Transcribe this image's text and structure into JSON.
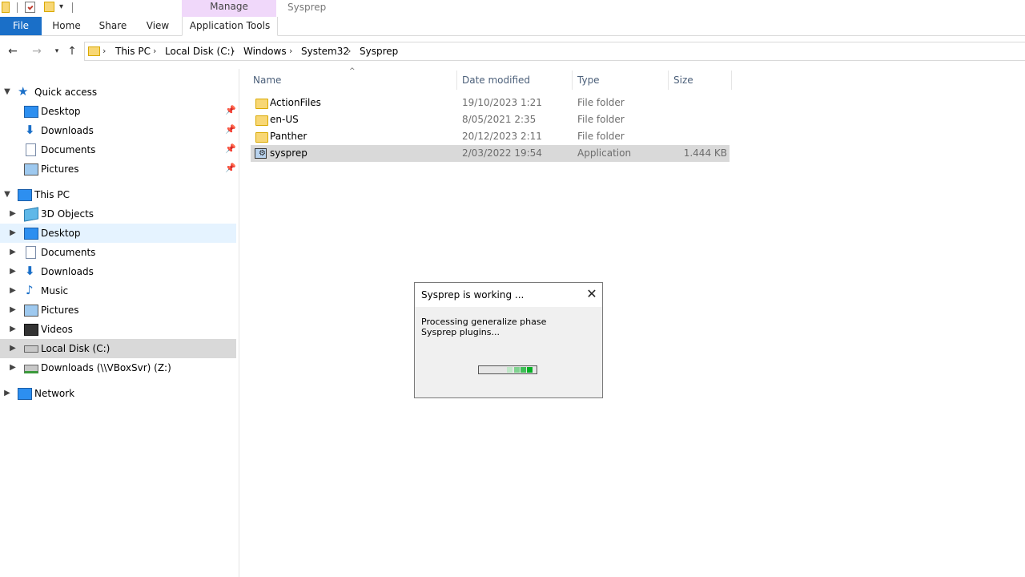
{
  "titlebar": {
    "manage_tab": "Manage",
    "window_title": "Sysprep"
  },
  "ribbon": {
    "tabs": [
      "File",
      "Home",
      "Share",
      "View",
      "Application Tools"
    ]
  },
  "address": {
    "breadcrumbs": [
      "This PC",
      "Local Disk (C:)",
      "Windows",
      "System32",
      "Sysprep"
    ]
  },
  "navpane": {
    "quick_access": "Quick access",
    "quick_items": [
      "Desktop",
      "Downloads",
      "Documents",
      "Pictures"
    ],
    "this_pc": "This PC",
    "pc_items": [
      "3D Objects",
      "Desktop",
      "Documents",
      "Downloads",
      "Music",
      "Pictures",
      "Videos",
      "Local Disk (C:)",
      "Downloads (\\\\VBoxSvr) (Z:)"
    ],
    "network": "Network"
  },
  "filelist": {
    "columns": [
      "Name",
      "Date modified",
      "Type",
      "Size"
    ],
    "rows": [
      {
        "name": "ActionFiles",
        "date": "19/10/2023 1:21",
        "type": "File folder",
        "size": ""
      },
      {
        "name": "en-US",
        "date": "8/05/2021 2:35",
        "type": "File folder",
        "size": ""
      },
      {
        "name": "Panther",
        "date": "20/12/2023 2:11",
        "type": "File folder",
        "size": ""
      },
      {
        "name": "sysprep",
        "date": "2/03/2022 19:54",
        "type": "Application",
        "size": "1.444 KB"
      }
    ]
  },
  "dialog": {
    "title": "Sysprep is working ...",
    "message": "Processing generalize phase Sysprep plugins..."
  },
  "colors": {
    "accent": "#1a6fc8",
    "manage": "#f0d8fa",
    "progress": "#06b025"
  }
}
